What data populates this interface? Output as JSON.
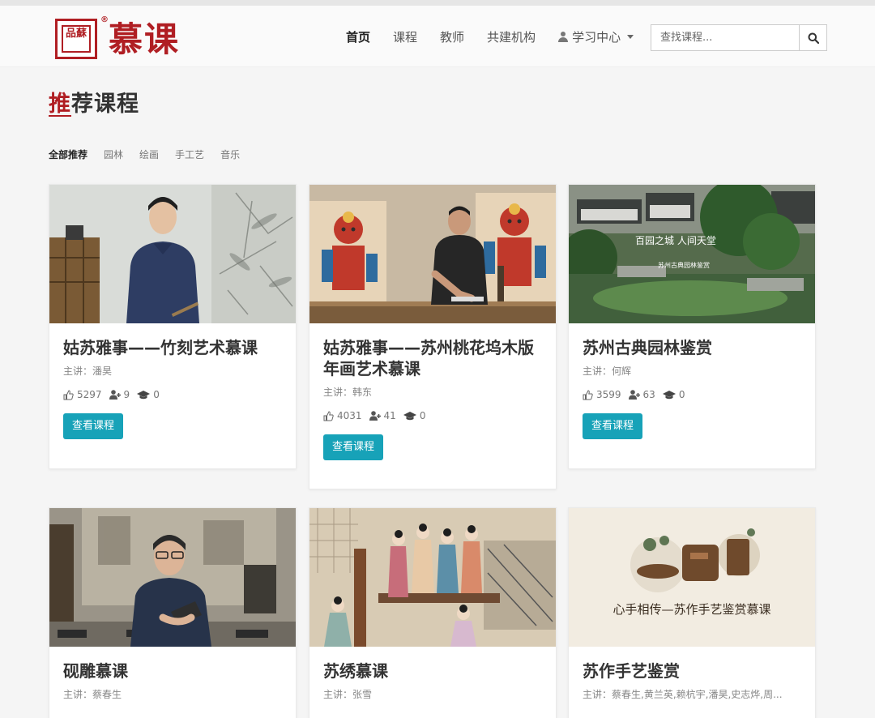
{
  "logo": {
    "seal_text": "品蘇",
    "reg_mark": "®",
    "title": "慕课"
  },
  "nav": {
    "home": "首页",
    "courses": "课程",
    "teachers": "教师",
    "partners": "共建机构",
    "learning_center": "学习中心"
  },
  "search": {
    "placeholder": "查找课程...",
    "value": ""
  },
  "section": {
    "title_first": "推",
    "title_rest": "荐课程"
  },
  "filters": [
    "全部推荐",
    "园林",
    "绘画",
    "手工艺",
    "音乐"
  ],
  "view_button_label": "查看课程",
  "courses": [
    {
      "title": "姑苏雅事——竹刻艺术慕课",
      "teacher": "主讲：潘昊",
      "views": "5297",
      "students": "9",
      "graduates": "0"
    },
    {
      "title": "姑苏雅事——苏州桃花坞木版年画艺术慕课",
      "teacher": "主讲：韩东",
      "views": "4031",
      "students": "41",
      "graduates": "0"
    },
    {
      "title": "苏州古典园林鉴赏",
      "teacher": "主讲：何辉",
      "views": "3599",
      "students": "63",
      "graduates": "0",
      "image_text": [
        "百园之城  人间天堂",
        "苏州古典园林鉴赏"
      ]
    },
    {
      "title": "砚雕慕课",
      "teacher": "主讲：蔡春生"
    },
    {
      "title": "苏绣慕课",
      "teacher": "主讲：张雪"
    },
    {
      "title": "苏作手艺鉴赏",
      "teacher": "主讲：蔡春生,黄兰英,赖杭宇,潘昊,史志烨,周...",
      "image_text": [
        "心手相传—苏作手艺鉴赏慕课"
      ]
    }
  ],
  "colors": {
    "brand_red": "#b01e23",
    "button_teal": "#17a2b8"
  }
}
